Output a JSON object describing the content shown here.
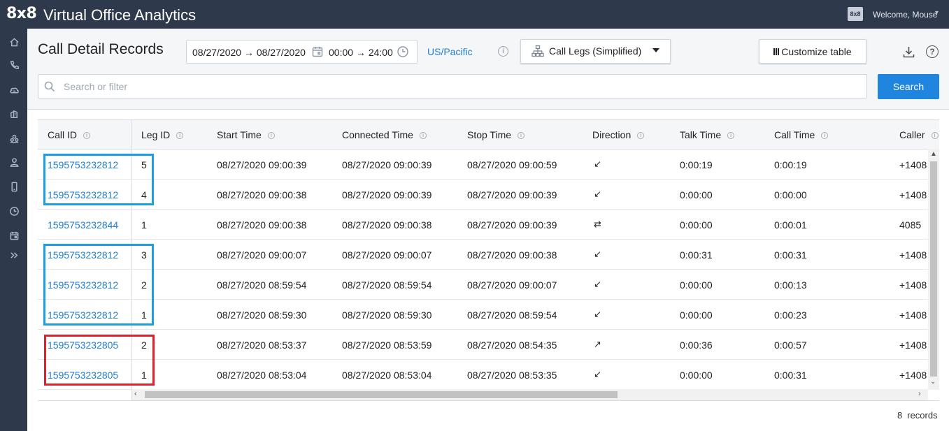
{
  "topbar": {
    "logo": "8x8",
    "title": "Virtual Office Analytics",
    "avatar": "8x8",
    "welcome": "Welcome, Mouse"
  },
  "sidebar": {
    "icons": [
      "home-icon",
      "phone-icon",
      "cloud-icon",
      "contact-center-icon",
      "group-icon",
      "user-icon",
      "mobile-icon",
      "clock-icon",
      "calendar-icon",
      "expand-icon"
    ]
  },
  "header": {
    "title": "Call Detail Records",
    "date_range": "08/27/2020 → 08/27/2020",
    "time_range": "00:00 → 24:00",
    "timezone": "US/Pacific",
    "view_select": "Call Legs (Simplified)",
    "customize_label": "Customize table"
  },
  "search": {
    "placeholder": "Search or filter",
    "button_label": "Search"
  },
  "table": {
    "columns": [
      "Call ID",
      "Leg ID",
      "Start Time",
      "Connected Time",
      "Stop Time",
      "Direction",
      "Talk Time",
      "Call Time",
      "Caller"
    ],
    "rows": [
      {
        "call_id": "1595753232812",
        "leg_id": "5",
        "start": "08/27/2020 09:00:39",
        "connected": "08/27/2020 09:00:39",
        "stop": "08/27/2020 09:00:59",
        "direction": "↙",
        "talk": "0:00:19",
        "call": "0:00:19",
        "caller": "+1408"
      },
      {
        "call_id": "1595753232812",
        "leg_id": "4",
        "start": "08/27/2020 09:00:38",
        "connected": "08/27/2020 09:00:39",
        "stop": "08/27/2020 09:00:39",
        "direction": "↙",
        "talk": "0:00:00",
        "call": "0:00:00",
        "caller": "+1408"
      },
      {
        "call_id": "1595753232844",
        "leg_id": "1",
        "start": "08/27/2020 09:00:38",
        "connected": "08/27/2020 09:00:38",
        "stop": "08/27/2020 09:00:39",
        "direction": "⇄",
        "talk": "0:00:00",
        "call": "0:00:01",
        "caller": "4085"
      },
      {
        "call_id": "1595753232812",
        "leg_id": "3",
        "start": "08/27/2020 09:00:07",
        "connected": "08/27/2020 09:00:07",
        "stop": "08/27/2020 09:00:38",
        "direction": "↙",
        "talk": "0:00:31",
        "call": "0:00:31",
        "caller": "+1408"
      },
      {
        "call_id": "1595753232812",
        "leg_id": "2",
        "start": "08/27/2020 08:59:54",
        "connected": "08/27/2020 08:59:54",
        "stop": "08/27/2020 09:00:07",
        "direction": "↙",
        "talk": "0:00:00",
        "call": "0:00:13",
        "caller": "+1408"
      },
      {
        "call_id": "1595753232812",
        "leg_id": "1",
        "start": "08/27/2020 08:59:30",
        "connected": "08/27/2020 08:59:30",
        "stop": "08/27/2020 08:59:54",
        "direction": "↙",
        "talk": "0:00:00",
        "call": "0:00:23",
        "caller": "+1408"
      },
      {
        "call_id": "1595753232805",
        "leg_id": "2",
        "start": "08/27/2020 08:53:37",
        "connected": "08/27/2020 08:53:59",
        "stop": "08/27/2020 08:54:35",
        "direction": "↗",
        "talk": "0:00:36",
        "call": "0:00:57",
        "caller": "+1408"
      },
      {
        "call_id": "1595753232805",
        "leg_id": "1",
        "start": "08/27/2020 08:53:04",
        "connected": "08/27/2020 08:53:04",
        "stop": "08/27/2020 08:53:35",
        "direction": "↙",
        "talk": "0:00:00",
        "call": "0:00:31",
        "caller": "+1408"
      }
    ]
  },
  "footer": {
    "count": "8",
    "label": "records"
  },
  "colors": {
    "topbar": "#2e3a4c",
    "accent": "#1f85de",
    "link": "#1f7ed0",
    "highlight_blue": "#1d9ee0",
    "highlight_red": "#e0212a"
  }
}
